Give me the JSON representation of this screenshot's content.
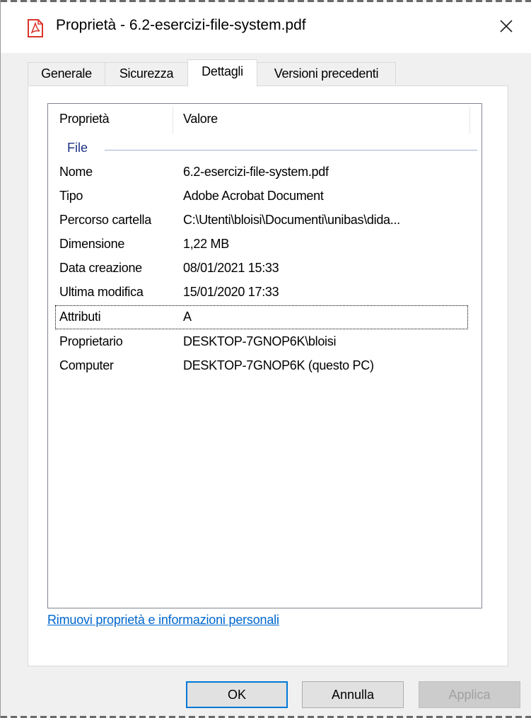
{
  "window": {
    "title": "Proprietà - 6.2-esercizi-file-system.pdf",
    "close_glyph": "✕"
  },
  "tabs": [
    {
      "label": "Generale"
    },
    {
      "label": "Sicurezza"
    },
    {
      "label": "Dettagli"
    },
    {
      "label": "Versioni precedenti"
    }
  ],
  "active_tab": "Dettagli",
  "table": {
    "headers": [
      "Proprietà",
      "Valore"
    ],
    "group": "File",
    "rows": [
      {
        "key": "Nome",
        "value": "6.2-esercizi-file-system.pdf"
      },
      {
        "key": "Tipo",
        "value": "Adobe Acrobat Document"
      },
      {
        "key": "Percorso cartella",
        "value": "C:\\Utenti\\bloisi\\Documenti\\unibas\\dida..."
      },
      {
        "key": "Dimensione",
        "value": "1,22 MB"
      },
      {
        "key": "Data creazione",
        "value": "08/01/2021 15:33"
      },
      {
        "key": "Ultima modifica",
        "value": "15/01/2020 17:33"
      },
      {
        "key": "Attributi",
        "value": "A"
      },
      {
        "key": "Proprietario",
        "value": "DESKTOP-7GNOP6K\\bloisi"
      },
      {
        "key": "Computer",
        "value": "DESKTOP-7GNOP6K (questo PC)"
      }
    ]
  },
  "link": "Rimuovi proprietà e informazioni personali",
  "buttons": {
    "ok": "OK",
    "cancel": "Annulla",
    "apply": "Applica"
  },
  "colors": {
    "accent": "#0078d7",
    "link": "#0066cc",
    "group_header": "#1e3287",
    "pdf_icon": "#d9342b"
  },
  "icons": {
    "app": "pdf-file-icon",
    "close": "close-icon"
  }
}
